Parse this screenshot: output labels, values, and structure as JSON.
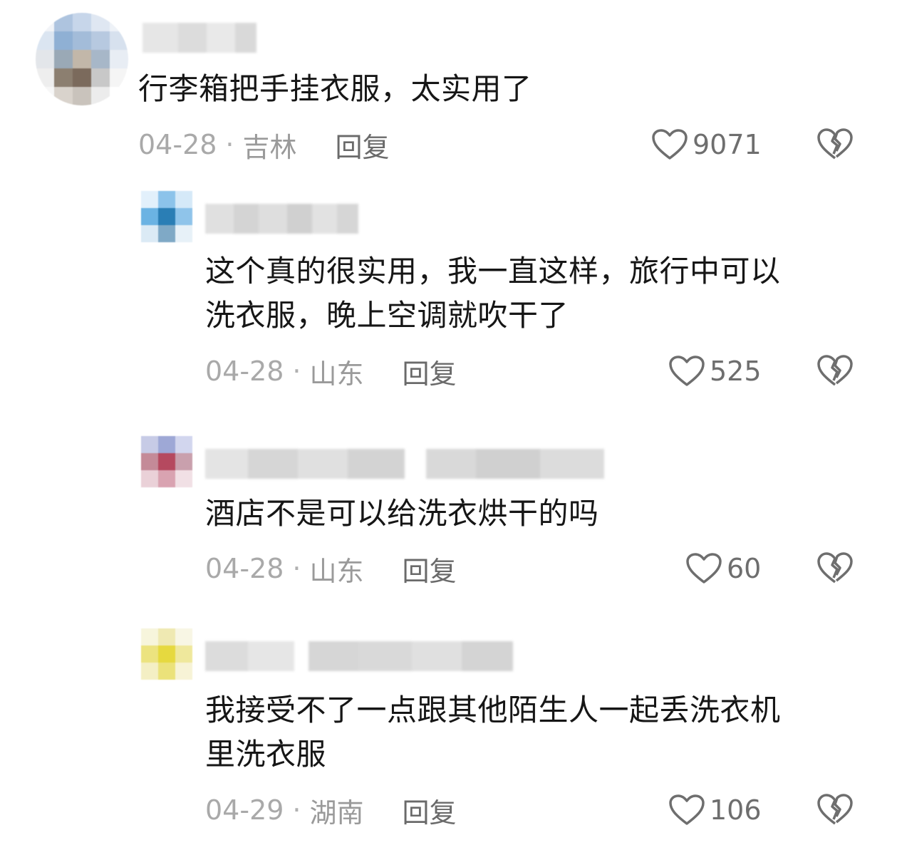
{
  "colors": {
    "text": "#161616",
    "meta": "#a9a9a9",
    "reply": "#6a6a6a",
    "icon": "#6e6e6e"
  },
  "comments": [
    {
      "text": "行李箱把手挂衣服，太实用了",
      "date": "04-28",
      "location": "吉林",
      "reply_label": "回复",
      "likes": "9071"
    },
    {
      "text": "这个真的很实用，我一直这样，旅行中可以\n洗衣服，晚上空调就吹干了",
      "date": "04-28",
      "location": "山东",
      "reply_label": "回复",
      "likes": "525"
    },
    {
      "text": "酒店不是可以给洗衣烘干的吗",
      "date": "04-28",
      "location": "山东",
      "reply_label": "回复",
      "likes": "60"
    },
    {
      "text": "我接受不了一点跟其他陌生人一起丢洗衣机\n里洗衣服",
      "date": "04-29",
      "location": "湖南",
      "reply_label": "回复",
      "likes": "106"
    }
  ]
}
